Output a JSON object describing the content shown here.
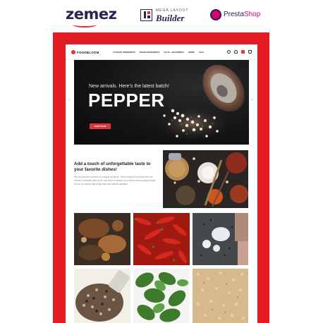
{
  "logos": {
    "zemes": "zemez",
    "mega_top": "MEGA LAYOUT",
    "mega_bottom": "Builder",
    "presta_a": "Presta",
    "presta_b": "Shop"
  },
  "store": {
    "brand": "FOODBLOOM",
    "nav": [
      "CULINARY INGREDIENTS",
      "BAKING INGREDIENTS",
      "SALTS + SEASONINGS",
      "HERBS",
      "SALE"
    ]
  },
  "hero": {
    "subtitle": "New arrivals. Here's the latest batch!",
    "title": "PEPPER",
    "button": "SHOP NOW"
  },
  "intro": {
    "heading": "Add a touch of unforgettable taste to your favorite dishes!",
    "body": "We are proud to present our unique products. The products of our store are the richest in delicate taste and if you want to season your dishes and cooking recipes to buy our spices that bring ease and natural pleasure."
  },
  "colors": {
    "frame": "#e31b23",
    "accent": "#e0343e",
    "brand_dark": "#2a2453"
  }
}
